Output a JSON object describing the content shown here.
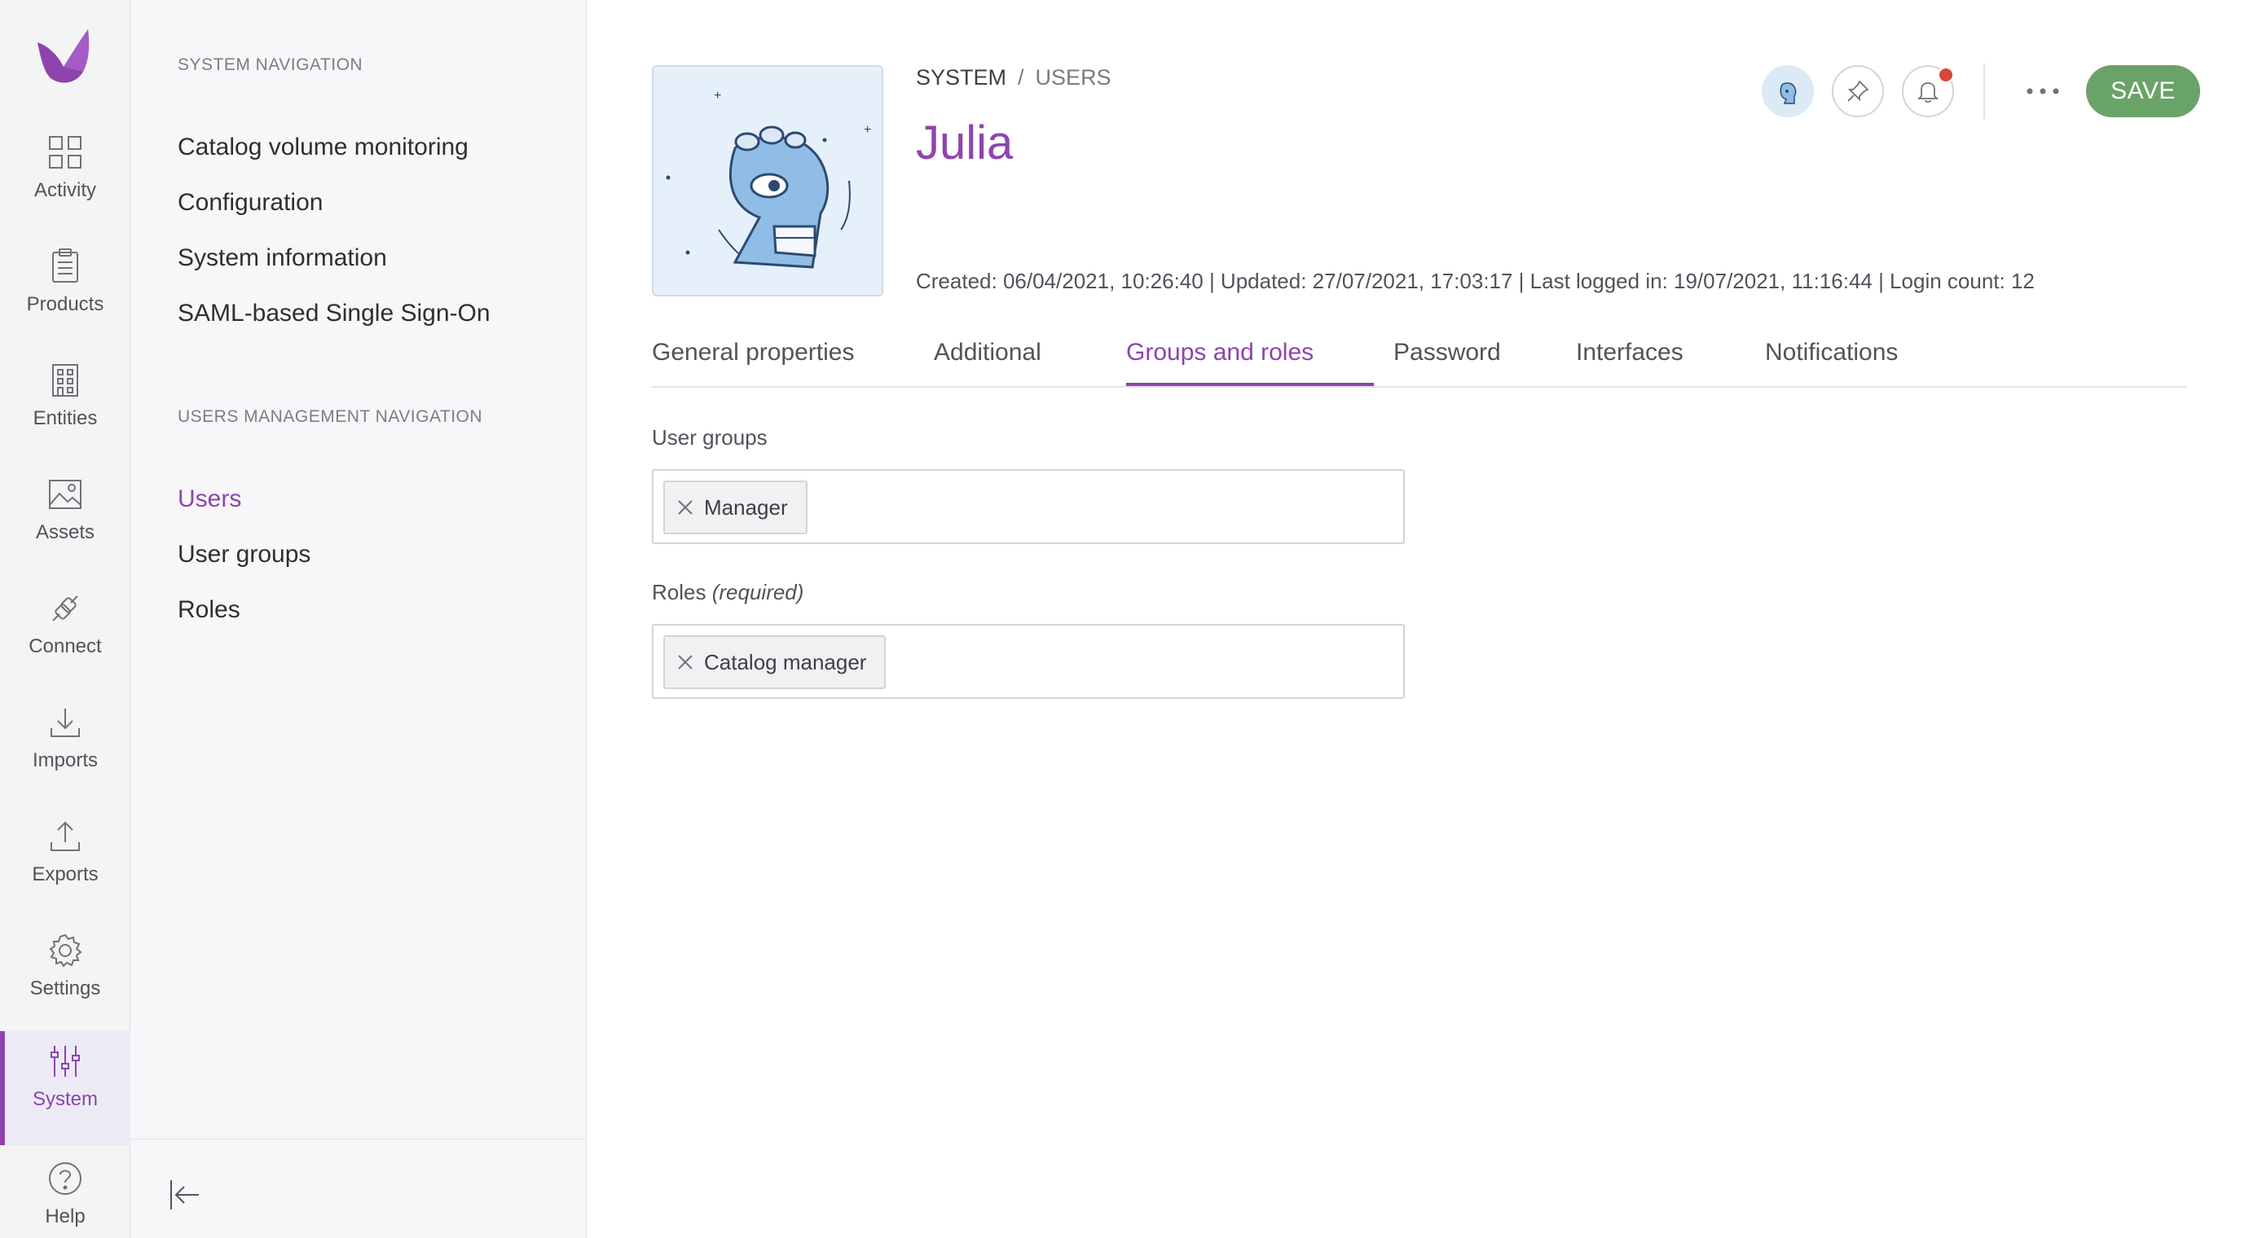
{
  "rail": {
    "items": [
      {
        "label": "Activity",
        "icon": "grid-icon"
      },
      {
        "label": "Products",
        "icon": "clipboard-icon"
      },
      {
        "label": "Entities",
        "icon": "building-icon"
      },
      {
        "label": "Assets",
        "icon": "image-icon"
      },
      {
        "label": "Connect",
        "icon": "plug-icon"
      },
      {
        "label": "Imports",
        "icon": "download-icon"
      },
      {
        "label": "Exports",
        "icon": "upload-icon"
      },
      {
        "label": "Settings",
        "icon": "gear-icon"
      },
      {
        "label": "System",
        "icon": "sliders-icon",
        "active": true
      },
      {
        "label": "Help",
        "icon": "help-icon"
      }
    ]
  },
  "subnav": {
    "system_title": "SYSTEM NAVIGATION",
    "system_links": [
      "Catalog volume monitoring",
      "Configuration",
      "System information",
      "SAML-based Single Sign-On"
    ],
    "users_title": "USERS MANAGEMENT NAVIGATION",
    "users_links": [
      "Users",
      "User groups",
      "Roles"
    ],
    "active_link": "Users"
  },
  "header": {
    "breadcrumb": [
      "SYSTEM",
      "USERS"
    ],
    "breadcrumb_separator": "/",
    "title": "Julia",
    "meta": "Created: 06/04/2021, 10:26:40 | Updated: 27/07/2021, 17:03:17 | Last logged in: 19/07/2021, 11:16:44 | Login count: 12",
    "save_label": "SAVE",
    "notification_badge": true
  },
  "tabs": [
    "General properties",
    "Additional",
    "Groups and roles",
    "Password",
    "Interfaces",
    "Notifications"
  ],
  "active_tab": "Groups and roles",
  "form": {
    "user_groups_label": "User groups",
    "user_groups": [
      "Manager"
    ],
    "roles_label": "Roles",
    "roles_qualifier": "(required)",
    "roles": [
      "Catalog manager"
    ]
  },
  "colors": {
    "accent": "#8e44ad",
    "save": "#6aa368",
    "badge": "#d9463b",
    "avatar_bg": "#e6f0fb"
  }
}
